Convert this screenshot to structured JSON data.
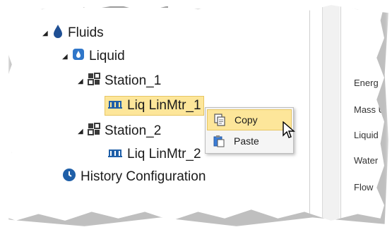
{
  "tree": {
    "fluids": {
      "label": "Fluids",
      "icon": "droplet-icon"
    },
    "liquid": {
      "label": "Liquid",
      "icon": "liquid-icon"
    },
    "station1": {
      "label": "Station_1",
      "icon": "station-icon"
    },
    "liq1": {
      "label": "Liq LinMtr_1",
      "icon": "meter-icon"
    },
    "station2": {
      "label": "Station_2",
      "icon": "station-icon"
    },
    "liq2": {
      "label": "Liq LinMtr_2",
      "icon": "meter-icon"
    },
    "history": {
      "label": "History Configuration",
      "icon": "clock-icon"
    }
  },
  "context_menu": {
    "copy": {
      "label": "Copy",
      "icon": "copy-icon"
    },
    "paste": {
      "label": "Paste",
      "icon": "paste-icon"
    }
  },
  "properties": {
    "labels": [
      "Energ",
      "Mass Ur",
      "Liquid",
      "Water",
      "Flow"
    ]
  },
  "colors": {
    "selection": "#fde69a",
    "selection_border": "#e7c663",
    "icon_blue": "#1f5fa8"
  }
}
